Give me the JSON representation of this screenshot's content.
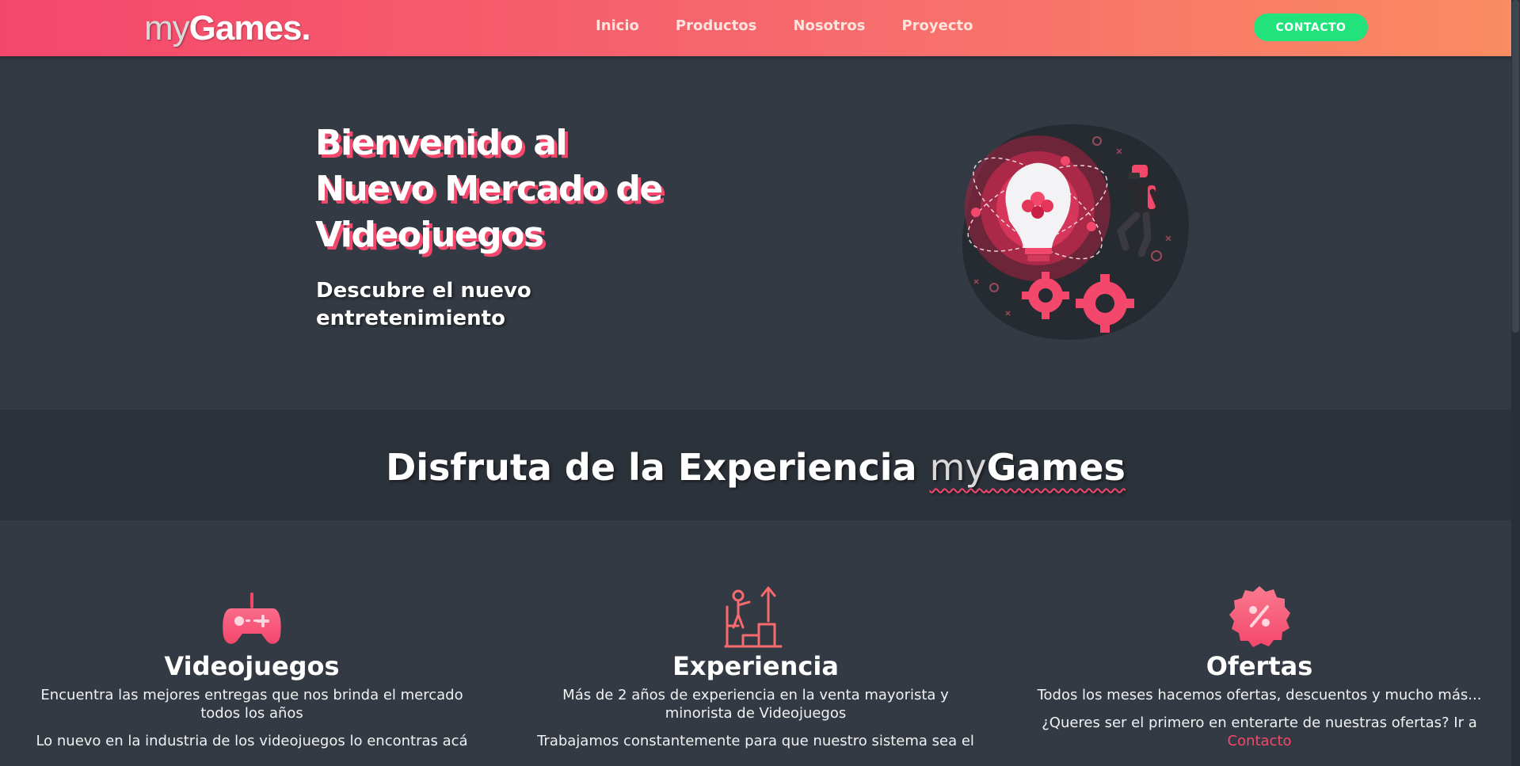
{
  "navbar": {
    "brand_my": "my",
    "brand_games": "Games.",
    "links": [
      "Inicio",
      "Productos",
      "Nosotros",
      "Proyecto"
    ],
    "contact_button": "CONTACTO"
  },
  "hero": {
    "title_lines": [
      "Bienvenido al",
      "Nuevo Mercado de",
      "Videojuegos"
    ],
    "subtitle": "Descubre el nuevo entretenimiento"
  },
  "band": {
    "title_prefix": "Disfruta de la Experiencia ",
    "brand_my": "my",
    "brand_games": "Games"
  },
  "features": [
    {
      "icon": "gamepad-icon",
      "title": "Videojuegos",
      "text": "Encuentra las mejores entregas que nos brinda el mercado todos los años",
      "text2": "Lo nuevo en la industria de los videojuegos lo encontras acá"
    },
    {
      "icon": "growth-stairs-icon",
      "title": "Experiencia",
      "text": "Más de 2 años de experiencia en la venta mayorista y minorista de Videojuegos",
      "text2": "Trabajamos constantemente para que nuestro sistema sea el"
    },
    {
      "icon": "discount-badge-icon",
      "title": "Ofertas",
      "text": "Todos los meses hacemos ofertas, descuentos y mucho más...",
      "text2": "¿Queres ser el primero en enterarte de nuestras ofertas? Ir a",
      "link": "Contacto"
    }
  ],
  "colors": {
    "accent": "#f4476c",
    "nav_gradient_end": "#fa8b62",
    "contact_green": "#22e27b",
    "background": "#343a44",
    "band_background": "#2c323a"
  }
}
